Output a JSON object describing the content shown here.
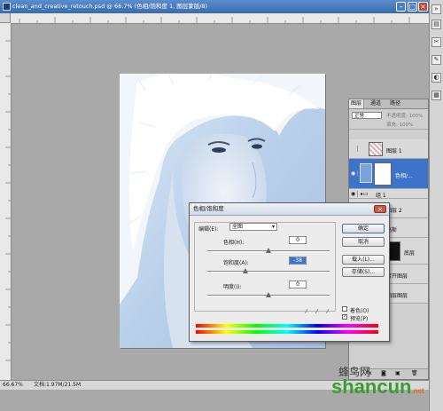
{
  "document": {
    "title": "clean_and_creative_retouch.psd @ 66.7% (色相/饱和度 1, 图层蒙版/8)",
    "zoom": "66.67%",
    "doc_size": "文档:1.97M/21.5M"
  },
  "layers_panel": {
    "tabs": [
      "图层",
      "通道",
      "路径"
    ],
    "blend_mode": "正常",
    "opacity_label": "不透明度: 100%",
    "fill_label": "填充: 100%",
    "rows": [
      {
        "name": "图层 1",
        "selected": false
      },
      {
        "name": "色相/...",
        "selected": true
      },
      {
        "name": "组 1",
        "selected": false
      },
      {
        "name": "图层 2",
        "selected": false
      },
      {
        "name": "高斯",
        "selected": false
      },
      {
        "name": "底层",
        "selected": false
      },
      {
        "name": "打开图层",
        "selected": false
      },
      {
        "name": "图层图层",
        "selected": false
      }
    ]
  },
  "dialog": {
    "title": "色相/饱和度",
    "edit_label": "编辑(E):",
    "edit_value": "全图",
    "hue_label": "色相(H):",
    "hue_value": "0",
    "hue_level": 0.5,
    "saturation_label": "饱和度(A):",
    "saturation_value": "-38",
    "saturation_level": 0.31,
    "lightness_label": "明度(I):",
    "lightness_value": "0",
    "lightness_level": 0.5,
    "buttons": {
      "ok": "确定",
      "cancel": "取消",
      "load": "载入(L)...",
      "save": "存储(S)..."
    },
    "colorize_label": "着色(O)",
    "colorize_checked": false,
    "preview_label": "预览(P)",
    "preview_checked": true
  },
  "watermark": {
    "cn": "蜂鸟网",
    "en": "shancun",
    "suffix": ".net"
  },
  "colors": {
    "title_bar": "#3a6bb0",
    "workspace": "#a9a9a9",
    "selected_layer": "#3d73c9",
    "watermark_green": "#3a9d2f",
    "watermark_orange": "#e06a1f"
  }
}
